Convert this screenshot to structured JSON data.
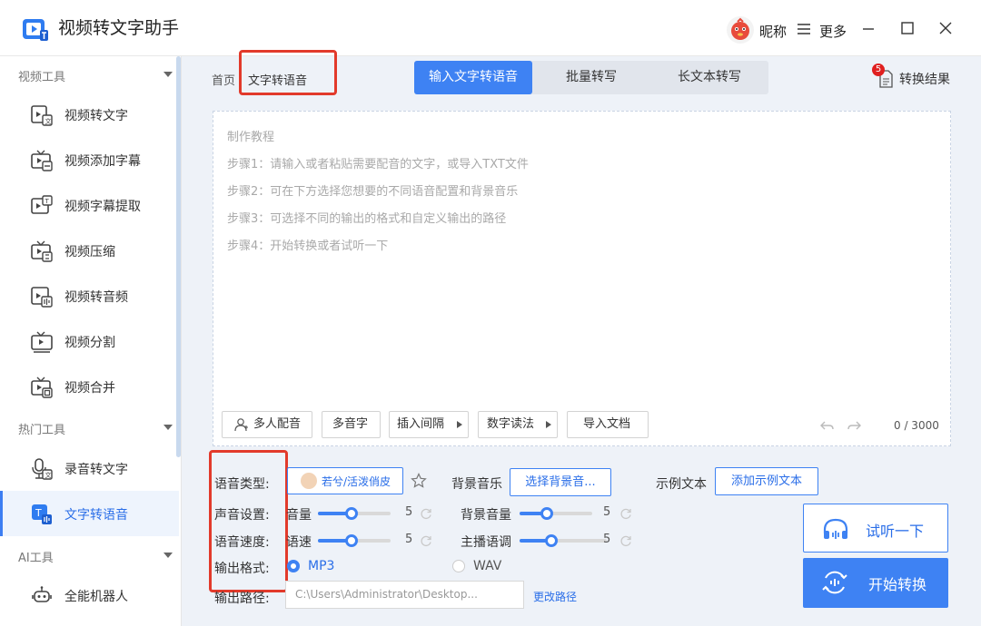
{
  "app": {
    "title": "视频转文字助手",
    "nickname": "昵称",
    "more": "更多"
  },
  "sidebar": {
    "groups": [
      {
        "title": "视频工具",
        "items": [
          "视频转文字",
          "视频添加字幕",
          "视频字幕提取",
          "视频压缩",
          "视频转音频",
          "视频分割",
          "视频合并"
        ]
      },
      {
        "title": "热门工具",
        "items": [
          "录音转文字",
          "文字转语音"
        ]
      },
      {
        "title": "AI工具",
        "items": [
          "全能机器人"
        ]
      }
    ],
    "active_item": "文字转语音"
  },
  "breadcrumb": {
    "home": "首页",
    "current": "文字转语音"
  },
  "tabs": [
    "输入文字转语音",
    "批量转写",
    "长文本转写"
  ],
  "active_tab": "输入文字转语音",
  "results": {
    "label": "转换结果",
    "badge": "5"
  },
  "editor": {
    "tutorial_title": "制作教程",
    "steps": [
      "步骤1：请输入或者粘贴需要配音的文字，或导入TXT文件",
      "步骤2：可在下方选择您想要的不同语音配置和背景音乐",
      "步骤3：可选择不同的输出的格式和自定义输出的路径",
      "步骤4：开始转换或者试听一下"
    ],
    "tools": {
      "multi_voice": "多人配音",
      "polyphone": "多音字",
      "insert_pause": "插入间隔",
      "number_reading": "数字读法",
      "import_doc": "导入文档"
    },
    "char_count": "0 / 3000"
  },
  "settings": {
    "voice_type_label": "语音类型:",
    "voice_name": "若兮/活泼俏皮",
    "bg_music_label": "背景音乐",
    "bg_music_button": "选择背景音...",
    "sample_text_label": "示例文本",
    "sample_text_button": "添加示例文本",
    "sound_settings_label": "声音设置:",
    "volume_label": "音量",
    "volume_value": "5",
    "bg_volume_label": "背景音量",
    "bg_volume_value": "5",
    "speed_settings_label": "语音速度:",
    "speed_label": "语速",
    "speed_value": "5",
    "pitch_label": "主播语调",
    "pitch_value": "5",
    "format_label": "输出格式:",
    "format_options": [
      "MP3",
      "WAV"
    ],
    "format_selected": "MP3",
    "path_label": "输出路径:",
    "path_value": "C:\\Users\\Administrator\\Desktop...",
    "change_path": "更改路径"
  },
  "actions": {
    "preview": "试听一下",
    "start": "开始转换"
  },
  "colors": {
    "accent": "#3E82F3",
    "highlight_box": "#E23A2B",
    "badge": "#E02020"
  }
}
